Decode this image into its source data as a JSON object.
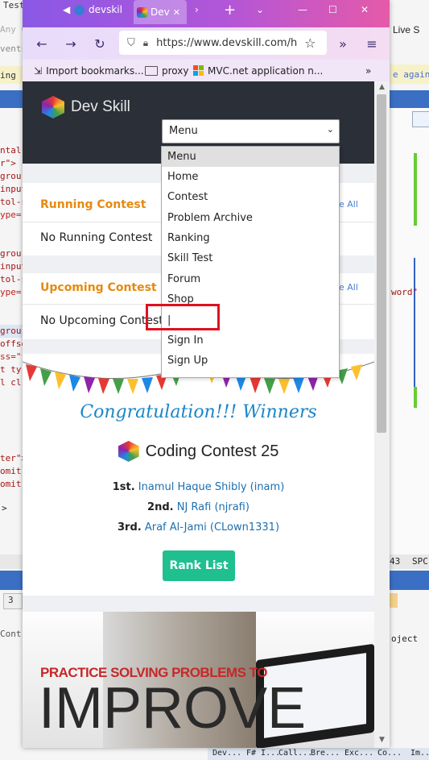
{
  "background": {
    "tab_test": "Test",
    "any_c": "Any C",
    "events": "vents",
    "ing_pa": "ing 'Pa",
    "live_s": "Live S",
    "e_again": "e again",
    "code_left": [
      "ntal\"",
      "r\">",
      "grou",
      "input",
      "tol-s",
      "ype=\"",
      "grou",
      "input",
      "tol-s",
      "ype=\"",
      "grou",
      "offse",
      "ss=\"f",
      "t ty",
      "l cl",
      "ter\">",
      "omit\"",
      "omit\"",
      ">"
    ],
    "word_right": "word\"",
    "num_43": "43",
    "spc": "SPC",
    "num_3": "3",
    "contro": "Contro",
    "oject": "oject",
    "bottom_tabs": [
      "Dev...",
      "F# I...",
      "Call...",
      "Bre...",
      "Exc...",
      "Co...",
      "Im..."
    ]
  },
  "browser": {
    "tab_title": "Dev",
    "tab_title2": "devskil",
    "url": "https://www.devskill.com/h",
    "bookmarks": [
      "Import bookmarks...",
      "proxy",
      "MVC.net application n..."
    ]
  },
  "site": {
    "brand": "Dev Skill",
    "menu_select_value": "Menu",
    "menu_options": [
      "Menu",
      "Home",
      "Contest",
      "Problem Archive",
      "Ranking",
      "Skill Test",
      "Forum",
      "Shop",
      "|",
      "Sign In",
      "Sign Up"
    ],
    "running_title": "Running Contest",
    "running_see_all": "e All",
    "running_text": "No Running Contest",
    "upcoming_title": "Upcoming Contest",
    "upcoming_see_all": "e All",
    "upcoming_text": "No Upcoming Contest",
    "congrats": "Congratulation!!! Winners",
    "contest_title": "Coding Contest 25",
    "winners": [
      {
        "rank": "1st.",
        "name": "Inamul Haque Shibly (inam)"
      },
      {
        "rank": "2nd.",
        "name": "NJ Rafi (njrafi)"
      },
      {
        "rank": "3rd.",
        "name": "Araf Al-Jami (CLown1331)"
      }
    ],
    "rank_list_button": "Rank List",
    "promo_line1": "PRACTICE SOLVING PROBLEMS TO",
    "promo_line2": "IMPROVE"
  },
  "colors": {
    "accent_orange": "#e58a10",
    "rank_button": "#1fbf8f",
    "link_blue": "#1c6fb0",
    "header_dark": "#2a2f38",
    "highlight_box": "#e01020"
  }
}
